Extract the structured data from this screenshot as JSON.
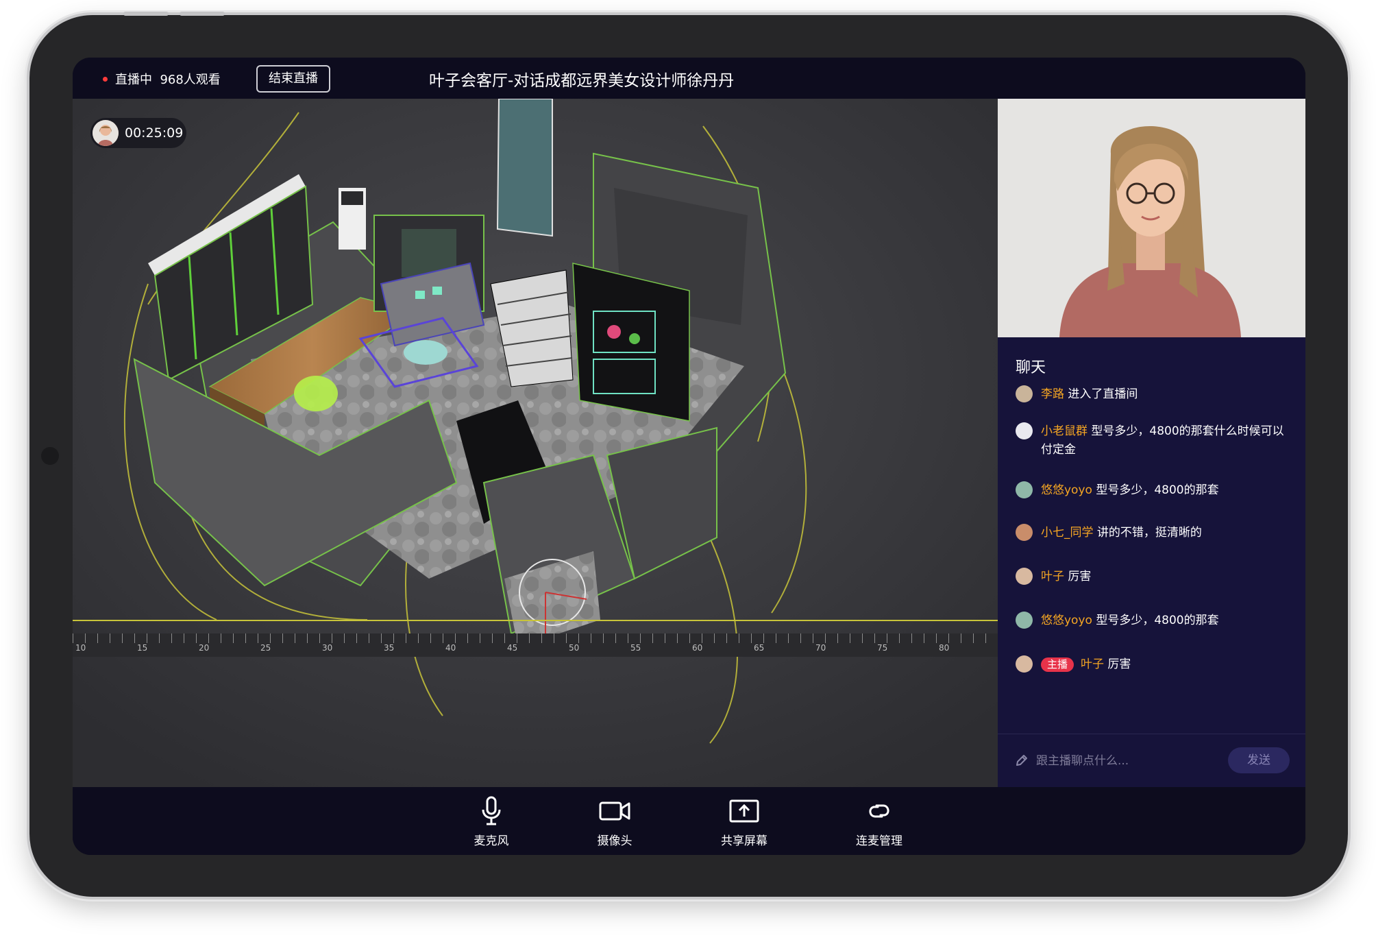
{
  "topbar": {
    "live_status": "直播中",
    "viewer_count": "968人观看",
    "end_button": "结束直播",
    "title": "叶子会客厅-对话成都远界美女设计师徐丹丹"
  },
  "video": {
    "timer": "00:25:09",
    "ruler_ticks": [
      "10",
      "15",
      "20",
      "25",
      "30",
      "35",
      "40",
      "45",
      "50",
      "55",
      "60",
      "65",
      "70",
      "75",
      "80"
    ]
  },
  "chat": {
    "title": "聊天",
    "messages": [
      {
        "name": "李路",
        "text": "进入了直播间",
        "badge": ""
      },
      {
        "name": "小老鼠群",
        "text": "型号多少，4800的那套什么时候可以付定金",
        "badge": ""
      },
      {
        "name": "悠悠yoyo",
        "text": "型号多少，4800的那套",
        "badge": ""
      },
      {
        "name": "小七_同学",
        "text": "讲的不错，挺清晰的",
        "badge": ""
      },
      {
        "name": "叶子",
        "text": "厉害",
        "badge": ""
      },
      {
        "name": "悠悠yoyo",
        "text": "型号多少，4800的那套",
        "badge": ""
      },
      {
        "name": "叶子",
        "text": "厉害",
        "badge": "主播"
      }
    ],
    "input_placeholder": "跟主播聊点什么...",
    "send_button": "发送"
  },
  "controls": {
    "microphone": "麦克风",
    "camera": "摄像头",
    "share_screen": "共享屏幕",
    "co_host": "连麦管理"
  },
  "colors": {
    "accent_name": "#f5a623",
    "live_dot": "#ff3b3b",
    "host_badge": "#e8334a",
    "chat_bg": "#16133a",
    "bar_bg": "#0d0c1e"
  }
}
